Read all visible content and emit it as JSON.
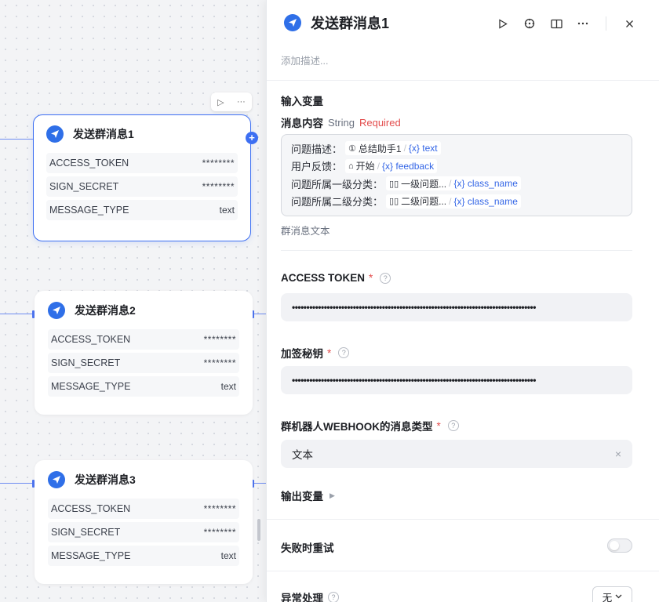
{
  "canvas": {
    "nodes": [
      {
        "title": "发送群消息1",
        "rows": [
          {
            "key": "ACCESS_TOKEN",
            "value": "********"
          },
          {
            "key": "SIGN_SECRET",
            "value": "********"
          },
          {
            "key": "MESSAGE_TYPE",
            "value": "text"
          }
        ]
      },
      {
        "title": "发送群消息2",
        "rows": [
          {
            "key": "ACCESS_TOKEN",
            "value": "********"
          },
          {
            "key": "SIGN_SECRET",
            "value": "********"
          },
          {
            "key": "MESSAGE_TYPE",
            "value": "text"
          }
        ]
      },
      {
        "title": "发送群消息3",
        "rows": [
          {
            "key": "ACCESS_TOKEN",
            "value": "********"
          },
          {
            "key": "SIGN_SECRET",
            "value": "********"
          },
          {
            "key": "MESSAGE_TYPE",
            "value": "text"
          }
        ]
      }
    ],
    "mini_toolbar": {
      "run_icon": "▷",
      "more_icon": "···"
    },
    "add_button": "+"
  },
  "panel": {
    "title": "发送群消息1",
    "description_placeholder": "添加描述...",
    "toolbar_icons": [
      "play-icon",
      "debug-icon",
      "book-icon",
      "more-icon",
      "close-icon"
    ],
    "input_section_title": "输入变量",
    "message_field": {
      "label": "消息内容",
      "type": "String",
      "required": "Required",
      "lines": [
        {
          "prefix": "问题描述：",
          "source_icon": "①",
          "source": "总结助手1",
          "var": "text"
        },
        {
          "prefix": "用户反馈：",
          "source_icon": "⌂",
          "source": "开始",
          "var": "feedback"
        },
        {
          "prefix": "问题所属一级分类：",
          "source_icon": "▯▯",
          "source": "一级问题...",
          "var": "class_name"
        },
        {
          "prefix": "问题所属二级分类：",
          "source_icon": "▯▯",
          "source": "二级问题...",
          "var": "class_name"
        }
      ],
      "var_prefix": "{x}",
      "hint": "群消息文本"
    },
    "access_token": {
      "label": "ACCESS TOKEN",
      "star": "*",
      "value": "••••••••••••••••••••••••••••••••••••••••••••••••••••••••••••••••••••••••••••••••••••"
    },
    "sign_secret": {
      "label": "加签秘钥",
      "star": "*",
      "value": "••••••••••••••••••••••••••••••••••••••••••••••••••••••••••••••••••••••••••••••••••••"
    },
    "message_type": {
      "label": "群机器人WEBHOOK的消息类型",
      "star": "*",
      "value": "文本",
      "clear_icon": "×"
    },
    "output_section_title": "输出变量",
    "retry_label": "失败时重试",
    "retry_enabled": false,
    "exception_label": "异常处理",
    "exception_value": "无"
  }
}
